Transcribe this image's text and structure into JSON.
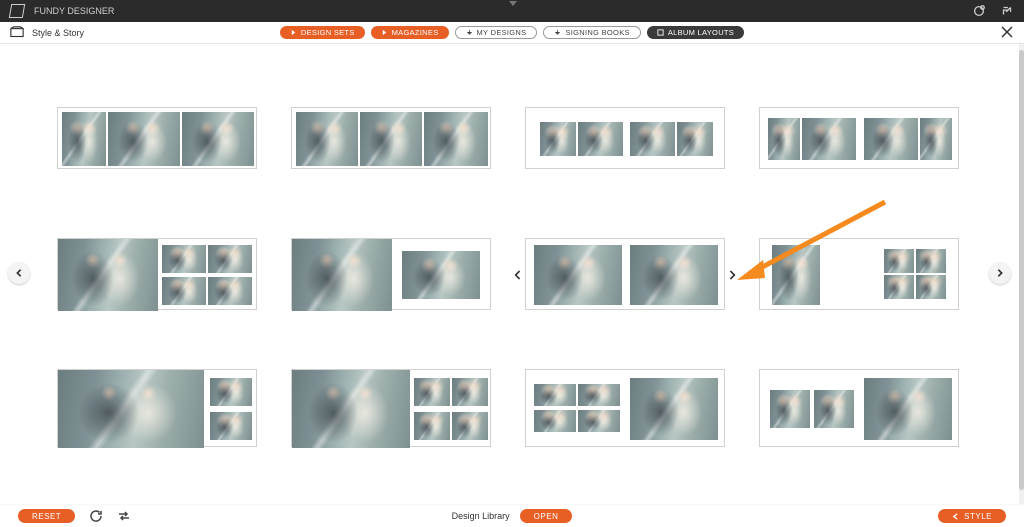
{
  "header": {
    "app_name": "FUNDY DESIGNER"
  },
  "subheader": {
    "title": "Style & Story"
  },
  "filters": {
    "design_sets": "DESIGN SETS",
    "magazines": "MAGAZINES",
    "my_designs": "MY DESIGNS",
    "signing_books": "SIGNING BOOKS",
    "album_layouts": "ALBUM LAYOUTS"
  },
  "footer": {
    "reset": "RESET",
    "library_label": "Design Library",
    "open": "OPEN",
    "style": "STYLE"
  },
  "layouts": {
    "rows": 3,
    "cols": 4
  }
}
